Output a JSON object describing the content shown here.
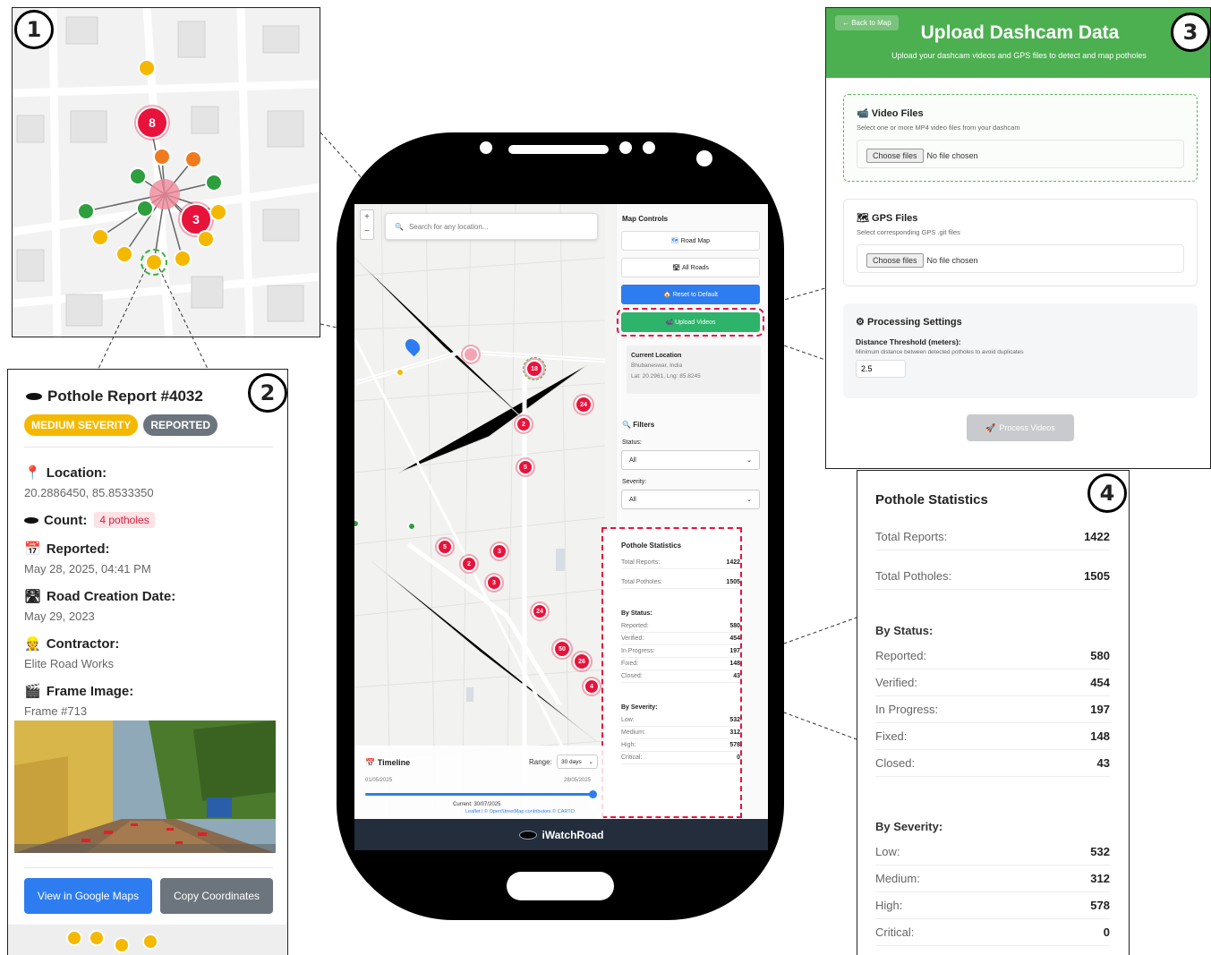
{
  "panel1": {
    "number": "1",
    "clusters": [
      {
        "count": "8"
      },
      {
        "count": "3"
      }
    ]
  },
  "panel2": {
    "number": "2",
    "title": "Pothole Report #4032",
    "severity_badge": "MEDIUM SEVERITY",
    "status_badge": "REPORTED",
    "location_label": "Location:",
    "location_value": "20.2886450, 85.8533350",
    "count_label": "Count:",
    "count_value": "4 potholes",
    "reported_label": "Reported:",
    "reported_value": "May 28, 2025, 04:41 PM",
    "road_label": "Road Creation Date:",
    "road_value": "May 29, 2023",
    "contractor_label": "Contractor:",
    "contractor_value": "Elite Road Works",
    "frame_label": "Frame Image:",
    "frame_value": "Frame #713",
    "maps_button": "View in Google Maps",
    "copy_button": "Copy Coordinates",
    "colors": {
      "severity": "#f5b800",
      "status": "#6c757d",
      "maps": "#2e7df0",
      "copy": "#6c757d"
    }
  },
  "phone": {
    "search_placeholder": "Search for any location...",
    "zoom_in": "+",
    "zoom_out": "−",
    "map_controls_title": "Map Controls",
    "road_map": "Road Map",
    "all_roads": "All Roads",
    "reset": "Reset to Default",
    "upload": "Upload Videos",
    "current_location_title": "Current Location",
    "current_location_city": "Bhubaneswar, India",
    "current_location_coords": "Lat: 20.2961, Lng: 85.8245",
    "filters_title": "Filters",
    "status_label": "Status:",
    "status_value": "All",
    "severity_label": "Severity:",
    "severity_value": "All",
    "stats_title": "Pothole Statistics",
    "total_reports_label": "Total Reports:",
    "total_reports": "1422",
    "total_potholes_label": "Total Potholes:",
    "total_potholes": "1505",
    "by_status": "By Status:",
    "status_rows": [
      {
        "label": "Reported:",
        "value": "580"
      },
      {
        "label": "Verified:",
        "value": "454"
      },
      {
        "label": "In Progress:",
        "value": "197"
      },
      {
        "label": "Fixed:",
        "value": "148"
      },
      {
        "label": "Closed:",
        "value": "43"
      }
    ],
    "by_severity": "By Severity:",
    "severity_rows": [
      {
        "label": "Low:",
        "value": "532"
      },
      {
        "label": "Medium:",
        "value": "312"
      },
      {
        "label": "High:",
        "value": "578"
      },
      {
        "label": "Critical:",
        "value": "0"
      }
    ],
    "clusters": [
      "18",
      "24",
      "2",
      "5",
      "5",
      "3",
      "2",
      "3",
      "24",
      "50",
      "26",
      "4"
    ],
    "timeline_title": "Timeline",
    "range_label": "Range:",
    "range_value": "30 days",
    "start_date": "01/05/2025",
    "end_date": "28/05/2025",
    "current_date": "Current: 30/07/2025",
    "attribution": "Leaflet | © OpenStreetMap contributors © CARTO",
    "app_name": "iWatchRoad"
  },
  "panel3": {
    "number": "3",
    "back_button": "← Back to Map",
    "title": "Upload Dashcam Data",
    "subtitle": "Upload your dashcam videos and GPS files to detect and map potholes",
    "video_title": "Video Files",
    "video_desc": "Select one or more MP4 video files from your dashcam",
    "gps_title": "GPS Files",
    "gps_desc": "Select corresponding GPS .git files",
    "choose_files": "Choose files",
    "no_file": "No file chosen",
    "processing_title": "Processing Settings",
    "threshold_label": "Distance Threshold (meters):",
    "threshold_desc": "Minimum distance between detected potholes to avoid duplicates",
    "threshold_value": "2.5",
    "process_button": "Process Videos",
    "colors": {
      "header": "#4caf50"
    }
  },
  "panel4": {
    "number": "4",
    "title": "Pothole Statistics",
    "total_reports_label": "Total Reports:",
    "total_reports": "1422",
    "total_potholes_label": "Total Potholes:",
    "total_potholes": "1505",
    "by_status": "By Status:",
    "status_rows": [
      {
        "label": "Reported:",
        "value": "580"
      },
      {
        "label": "Verified:",
        "value": "454"
      },
      {
        "label": "In Progress:",
        "value": "197"
      },
      {
        "label": "Fixed:",
        "value": "148"
      },
      {
        "label": "Closed:",
        "value": "43"
      }
    ],
    "by_severity": "By Severity:",
    "severity_rows": [
      {
        "label": "Low:",
        "value": "532"
      },
      {
        "label": "Medium:",
        "value": "312"
      },
      {
        "label": "High:",
        "value": "578"
      },
      {
        "label": "Critical:",
        "value": "0"
      }
    ]
  }
}
